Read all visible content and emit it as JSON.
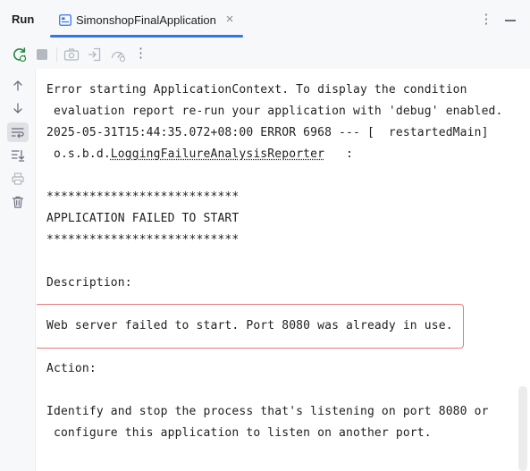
{
  "header": {
    "panel_title": "Run",
    "tab_label": "SimonshopFinalApplication",
    "tab_close_glyph": "×",
    "more_glyph": "⋮"
  },
  "toolbar": {
    "buttons": [
      {
        "icon": "rerun-icon",
        "enabled": true
      },
      {
        "icon": "stop-icon",
        "enabled": false
      },
      {
        "icon": "camera-icon",
        "enabled": false
      },
      {
        "icon": "restore-layout-icon",
        "enabled": false
      },
      {
        "icon": "debug-settings-icon",
        "enabled": false
      }
    ],
    "more_glyph": "⋮"
  },
  "gutter": {
    "buttons": [
      {
        "icon": "arrow-up-icon"
      },
      {
        "icon": "arrow-down-icon"
      },
      {
        "icon": "soft-wrap-icon",
        "active": true
      },
      {
        "icon": "scroll-to-end-icon"
      },
      {
        "icon": "print-icon",
        "enabled": false
      },
      {
        "icon": "trash-icon"
      }
    ]
  },
  "console": {
    "lines": {
      "l1": "Error starting ApplicationContext. To display the condition",
      "l2": " evaluation report re-run your application with 'debug' enabled.",
      "l3": "2025-05-31T15:44:35.072+08:00 ERROR 6968 --- [  restartedMain]",
      "l4_prefix": " o.s.b.d.",
      "l4_link": "LoggingFailureAnalysisReporter",
      "l4_suffix": "   :",
      "l5": "***************************",
      "l6": "APPLICATION FAILED TO START",
      "l7": "***************************",
      "l8": "Description:",
      "l9": "Web server failed to start. Port 8080 was already in use.",
      "l10": "Action:",
      "l11": "Identify and stop the process that's listening on port 8080 or",
      "l12": " configure this application to listen on another port."
    }
  },
  "colors": {
    "accent": "#3574f0",
    "highlight_border": "#e8787b",
    "rerun_green": "#208a3c",
    "icon_gray": "#6c707e",
    "icon_disabled": "#b4b8bf"
  }
}
